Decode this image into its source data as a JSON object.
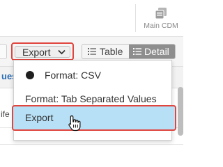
{
  "header": {
    "cdm_button_label": "Main CDM",
    "cdm_icon": "database-copy-icon"
  },
  "toolbar": {
    "export_label": "Export",
    "export_icon": "chevron-down-icon",
    "view_toggle": {
      "table_label": "Table",
      "detail_label": "Detail",
      "selected": "Detail"
    }
  },
  "table": {
    "header_fragment": "ues",
    "row_fragment": "ife"
  },
  "export_menu": {
    "items": [
      {
        "label": "Format: CSV",
        "selected": true
      },
      {
        "label": "Format: Tab Separated Values",
        "selected": false
      },
      {
        "label": "Export",
        "selected": false,
        "hovered": true
      }
    ]
  },
  "colors": {
    "highlight_outline": "#e0453e",
    "hover_background": "#b7e0f6",
    "detail_toggle_active": "#8e8e8e",
    "link_text": "#2a6db5"
  }
}
